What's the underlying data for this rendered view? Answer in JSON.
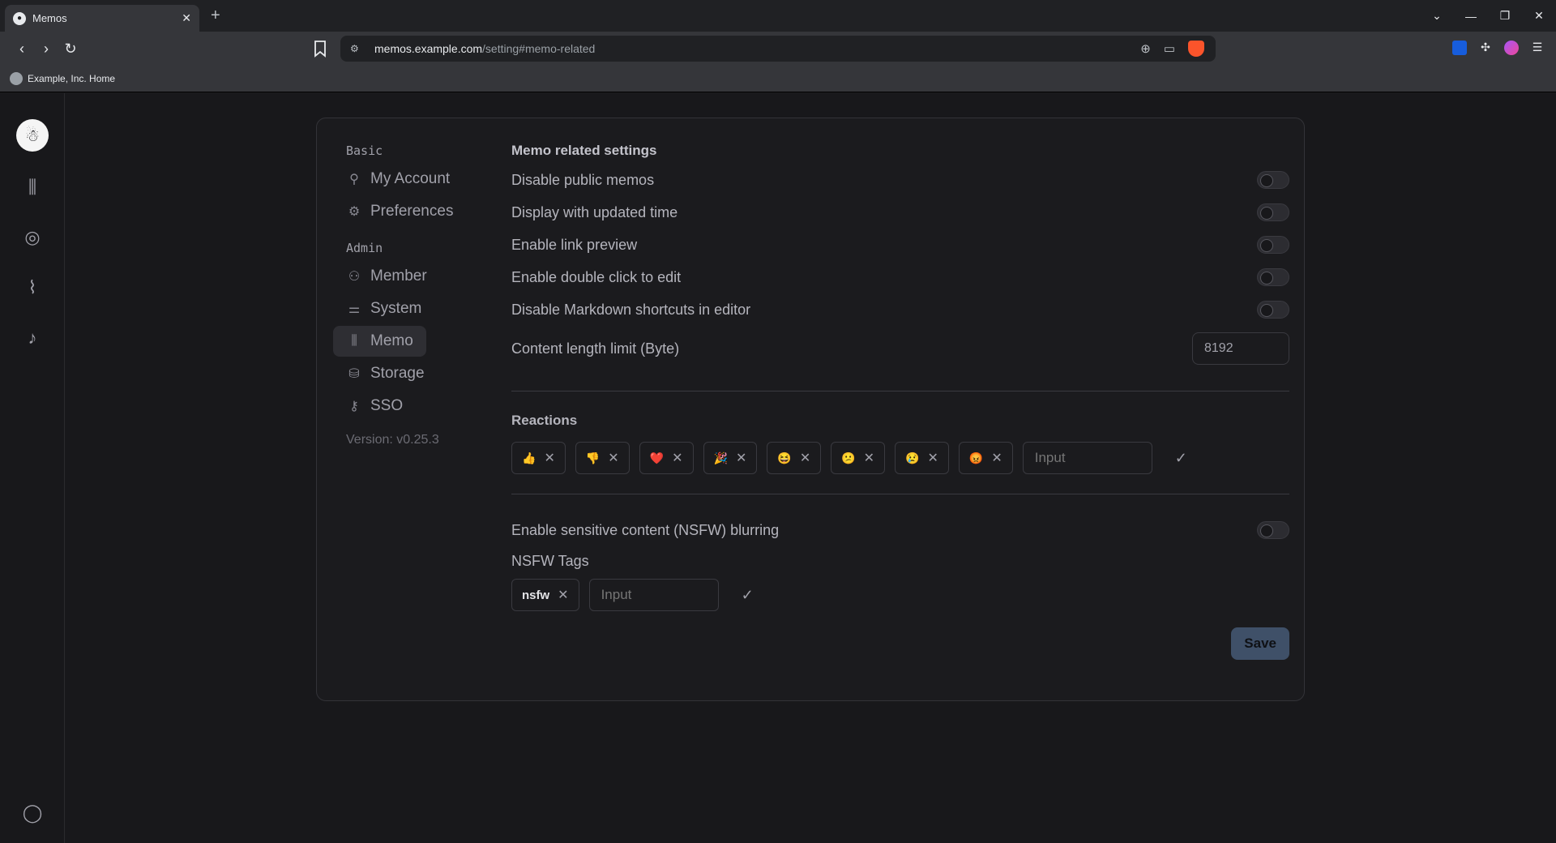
{
  "browser": {
    "tab_title": "Memos",
    "url_host": "memos.example.com",
    "url_path": "/setting#memo-related",
    "bookmark_label": "Example, Inc. Home"
  },
  "settings_nav": {
    "basic_label": "Basic",
    "basic_items": [
      {
        "label": "My Account",
        "icon": "user-icon"
      },
      {
        "label": "Preferences",
        "icon": "gear-icon"
      }
    ],
    "admin_label": "Admin",
    "admin_items": [
      {
        "label": "Member",
        "icon": "users-icon"
      },
      {
        "label": "System",
        "icon": "sliders-icon"
      },
      {
        "label": "Memo",
        "icon": "library-icon"
      },
      {
        "label": "Storage",
        "icon": "database-icon"
      },
      {
        "label": "SSO",
        "icon": "key-icon"
      }
    ],
    "active": "Memo",
    "version": "Version: v0.25.3"
  },
  "memo_settings": {
    "title": "Memo related settings",
    "toggles": [
      {
        "label": "Disable public memos",
        "on": false
      },
      {
        "label": "Display with updated time",
        "on": false
      },
      {
        "label": "Enable link preview",
        "on": false
      },
      {
        "label": "Enable double click to edit",
        "on": false
      },
      {
        "label": "Disable Markdown shortcuts in editor",
        "on": false
      }
    ],
    "content_limit_label": "Content length limit (Byte)",
    "content_limit_value": "8192"
  },
  "reactions": {
    "title": "Reactions",
    "items": [
      "👍",
      "👎",
      "❤️",
      "🎉",
      "😆",
      "😕",
      "😢",
      "😡"
    ],
    "input_placeholder": "Input"
  },
  "nsfw": {
    "toggle_label": "Enable sensitive content (NSFW) blurring",
    "toggle_on": false,
    "tags_label": "NSFW Tags",
    "tags": [
      "nsfw"
    ],
    "input_placeholder": "Input"
  },
  "save_label": "Save"
}
